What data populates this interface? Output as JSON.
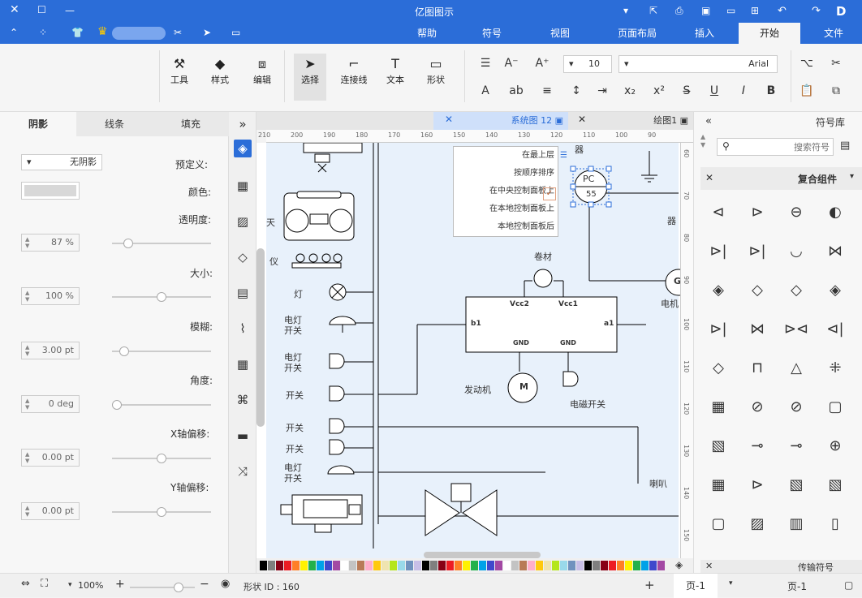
{
  "app": {
    "title": "亿图图示",
    "user_name": "",
    "brand_color": "#2b6dd8"
  },
  "menu": {
    "tabs": [
      "文件",
      "开始",
      "插入",
      "页面布局",
      "视图",
      "符号",
      "帮助"
    ],
    "active": "开始"
  },
  "ribbon": {
    "font_name": "Arial",
    "font_size": "10",
    "tools": [
      {
        "label": "形状",
        "icon": "rectangle-icon"
      },
      {
        "label": "文本",
        "icon": "text-icon"
      },
      {
        "label": "连接线",
        "icon": "connector-icon"
      },
      {
        "label": "选择",
        "icon": "pointer-icon"
      },
      {
        "label": "编辑",
        "icon": "edit-icon"
      },
      {
        "label": "样式",
        "icon": "style-icon"
      },
      {
        "label": "工具",
        "icon": "tools-icon"
      }
    ]
  },
  "left_panel": {
    "tabs": [
      "阴影",
      "线条",
      "填充"
    ],
    "active_tab": "阴影",
    "preset_label": "预定义:",
    "preset_value": "无阴影",
    "color_label": "颜色:",
    "transparency_label": "透明度:",
    "transparency_value": "87 %",
    "transparency_level": 0.13,
    "size_label": "大小:",
    "size_value": "100 %",
    "size_level": 0.5,
    "blur_label": "模糊:",
    "blur_value": "3.00 pt",
    "blur_level": 0.08,
    "angle_label": "角度:",
    "angle_value": "0 deg",
    "angle_level": 0.0,
    "xoffset_label": "X轴偏移:",
    "xoffset_value": "0.00 pt",
    "xoffset_level": 0.5,
    "yoffset_label": "Y轴偏移:",
    "yoffset_value": "0.00 pt",
    "yoffset_level": 0.5
  },
  "doc_tabs": [
    {
      "label": "绘图1",
      "active": false
    },
    {
      "label": "系统图 12",
      "active": true
    }
  ],
  "rulers": {
    "horizontal": [
      "90",
      "100",
      "110",
      "120",
      "130",
      "140",
      "150",
      "160",
      "170",
      "180",
      "190",
      "200",
      "210"
    ],
    "vertical": [
      "60",
      "70",
      "80",
      "90",
      "100",
      "110",
      "120",
      "130",
      "140",
      "150"
    ]
  },
  "context_menu": {
    "items": [
      "在最上层",
      "按顺序排序",
      "在中央控制面板上",
      "在本地控制面板上",
      "本地控制面板后"
    ]
  },
  "canvas_labels": {
    "lamp": "灯",
    "electric_switch_1": "电灯开关",
    "electric_switch_2": "电灯开关",
    "switch_1": "开关",
    "switch_2": "开关",
    "switch_3": "开关",
    "electric_switch_3": "电灯开关",
    "coil": "卷材",
    "motor": "发动机",
    "motor_symbol": "M",
    "relay_switch": "电磁开关",
    "horn": "喇叭",
    "pc": "PC",
    "pc_num": "55",
    "chip_vcc1": "Vcc1",
    "chip_vcc2": "Vcc2",
    "chip_a1": "a1",
    "chip_b1": "b1",
    "chip_gnd1": "GND",
    "chip_gnd2": "GND",
    "side_1": "天",
    "side_2": "仪",
    "right_1": "器",
    "right_2": "电机",
    "right_3": "器",
    "g_label": "G"
  },
  "right_panel": {
    "title": "符号库",
    "search_placeholder": "搜索符号",
    "section": "复合组件",
    "section_bottom": "传输符号"
  },
  "status": {
    "page_select": "页-1",
    "page_tab": "页-1",
    "shape_id": "形状 ID : 160",
    "zoom": "100%"
  },
  "palette_colors": [
    "#000000",
    "#7f7f7f",
    "#880015",
    "#ed1c24",
    "#ff7f27",
    "#fff200",
    "#22b14c",
    "#00a2e8",
    "#3f48cc",
    "#a349a4",
    "#ffffff",
    "#c3c3c3",
    "#b97a57",
    "#ffaec9",
    "#ffc90e",
    "#efe4b0",
    "#b5e61d",
    "#99d9ea",
    "#7092be",
    "#c8bfe7"
  ]
}
